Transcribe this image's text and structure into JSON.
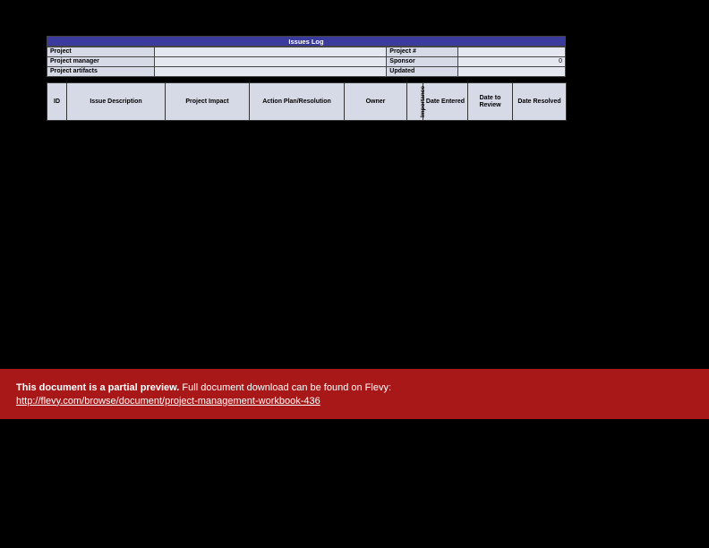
{
  "title": "Issues Log",
  "meta": {
    "row1": {
      "label1": "Project",
      "val1": "",
      "label2": "Project #",
      "val2": ""
    },
    "row2": {
      "label1": "Project manager",
      "val1": "",
      "label2": "Sponsor",
      "val2": "0"
    },
    "row3": {
      "label1": "Project artifacts",
      "val1": "",
      "label2": "Updated",
      "val2": ""
    }
  },
  "columns": {
    "id": "ID",
    "desc": "Issue Description",
    "impact": "Project Impact",
    "action": "Action Plan/Resolution",
    "owner": "Owner",
    "importance": "Importance",
    "date_entered": "Date Entered",
    "date_review": "Date to Review",
    "date_resolved": "Date Resolved"
  },
  "banner": {
    "bold": "This document is a partial preview.",
    "rest": "  Full document download can be found on Flevy:",
    "link_text": "http://flevy.com/browse/document/project-management-workbook-436"
  }
}
